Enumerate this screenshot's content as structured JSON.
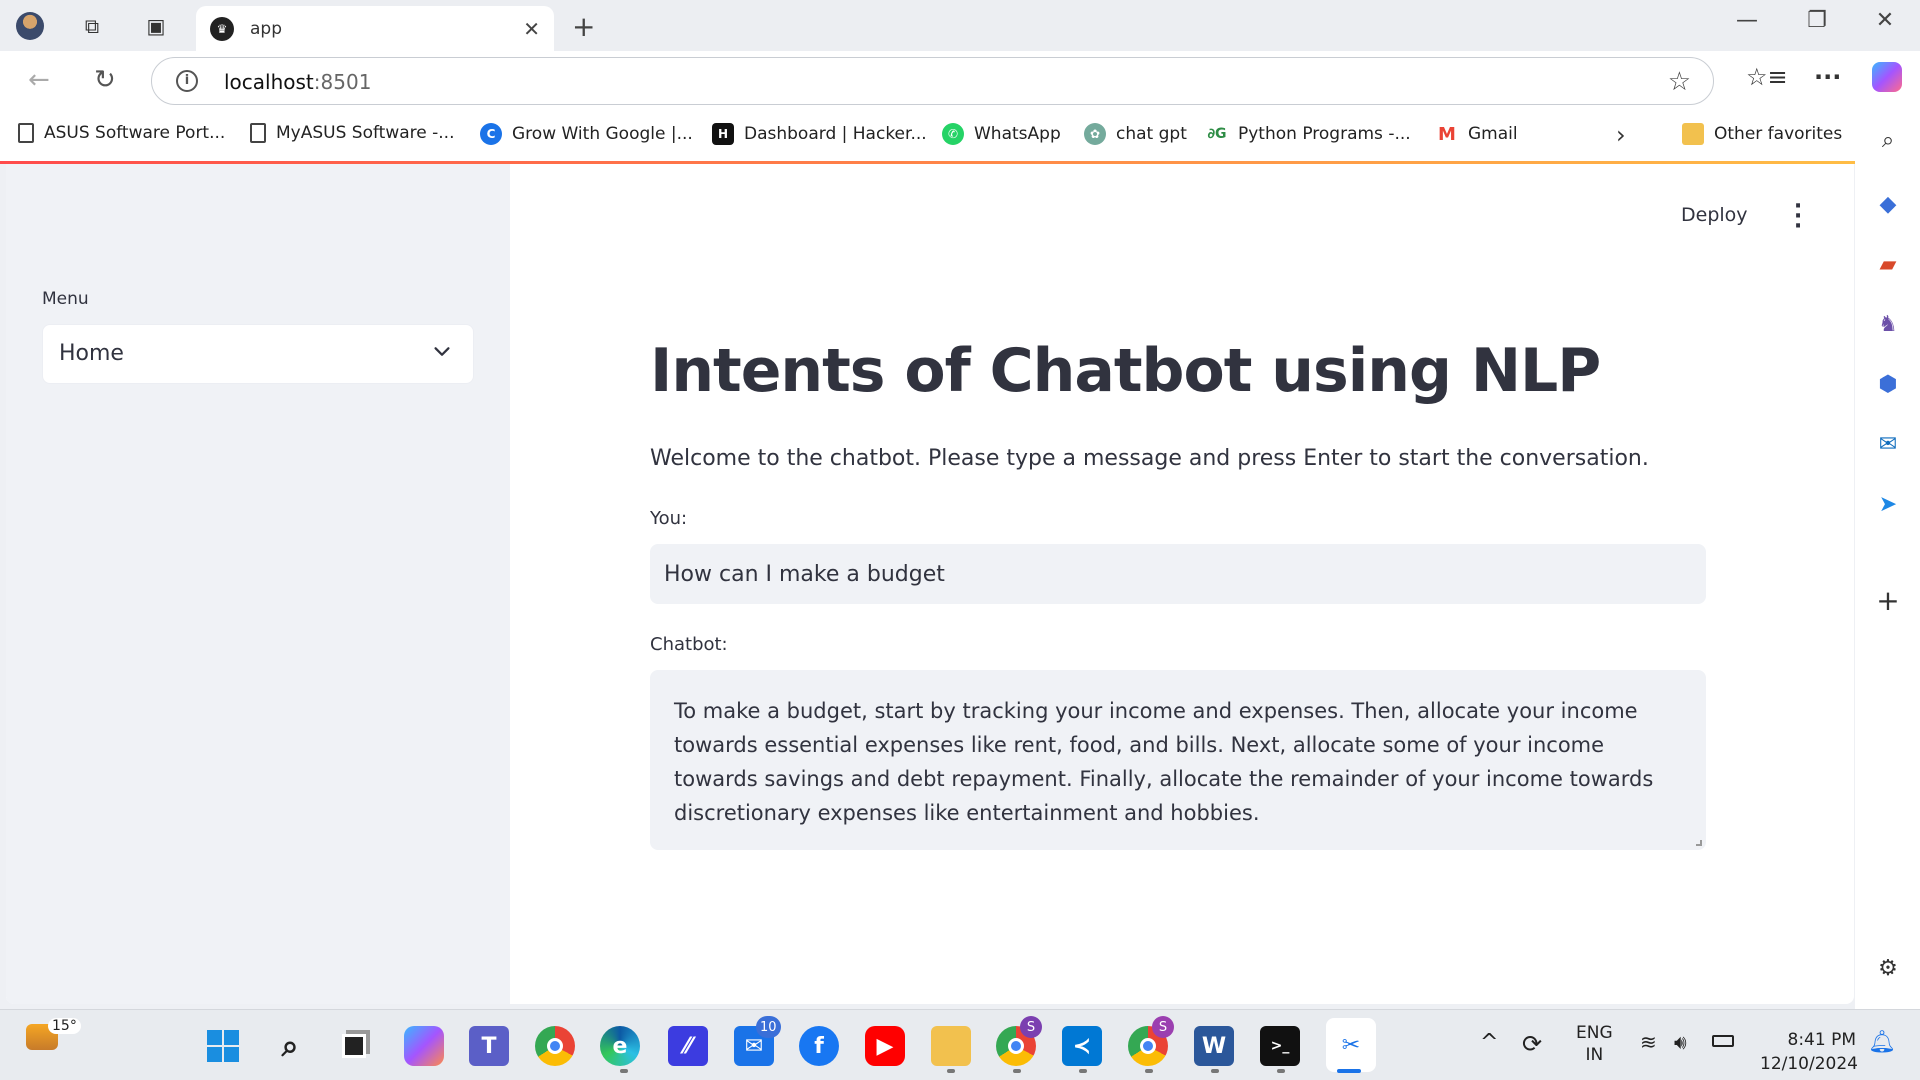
{
  "browser": {
    "tab_title": "app",
    "url_host": "localhost",
    "url_port": ":8501",
    "favorites": [
      {
        "label": "ASUS Software Port...",
        "icon": "page-icon",
        "color": "#444444"
      },
      {
        "label": "MyASUS Software -...",
        "icon": "page-icon",
        "color": "#444444"
      },
      {
        "label": "Grow With Google |...",
        "icon": "google-c-icon",
        "color": "#1a73e8"
      },
      {
        "label": "Dashboard | Hacker...",
        "icon": "hackerrank-icon",
        "color": "#111111"
      },
      {
        "label": "WhatsApp",
        "icon": "whatsapp-icon",
        "color": "#25d366"
      },
      {
        "label": "chat gpt",
        "icon": "chatgpt-icon",
        "color": "#74aa9c"
      },
      {
        "label": "Python Programs -...",
        "icon": "gfg-icon",
        "color": "#2f8d46"
      },
      {
        "label": "Gmail",
        "icon": "gmail-icon",
        "color": "#ea4335"
      }
    ],
    "other_favorites": "Other favorites"
  },
  "app": {
    "deploy_label": "Deploy",
    "sidebar": {
      "menu_label": "Menu",
      "menu_value": "Home"
    },
    "title": "Intents of Chatbot using NLP",
    "welcome": "Welcome to the chatbot. Please type a message and press Enter to start the conversation.",
    "you_label": "You:",
    "you_value": "How can I make a budget",
    "chatbot_label": "Chatbot:",
    "chatbot_response": "To make a budget, start by tracking your income and expenses. Then, allocate your income towards essential expenses like rent, food, and bills. Next, allocate some of your income towards savings and debt repayment. Finally, allocate the remainder of your income towards discretionary expenses like entertainment and hobbies."
  },
  "taskbar": {
    "temperature": "15°",
    "mail_badge": "10",
    "chrome_badge": "S",
    "lang_top": "ENG",
    "lang_bottom": "IN",
    "time": "8:41 PM",
    "date": "12/10/2024"
  },
  "colors": {
    "accent": "#ff4b4b",
    "sidebar_bg": "#f0f2f6",
    "text": "#31333f"
  }
}
